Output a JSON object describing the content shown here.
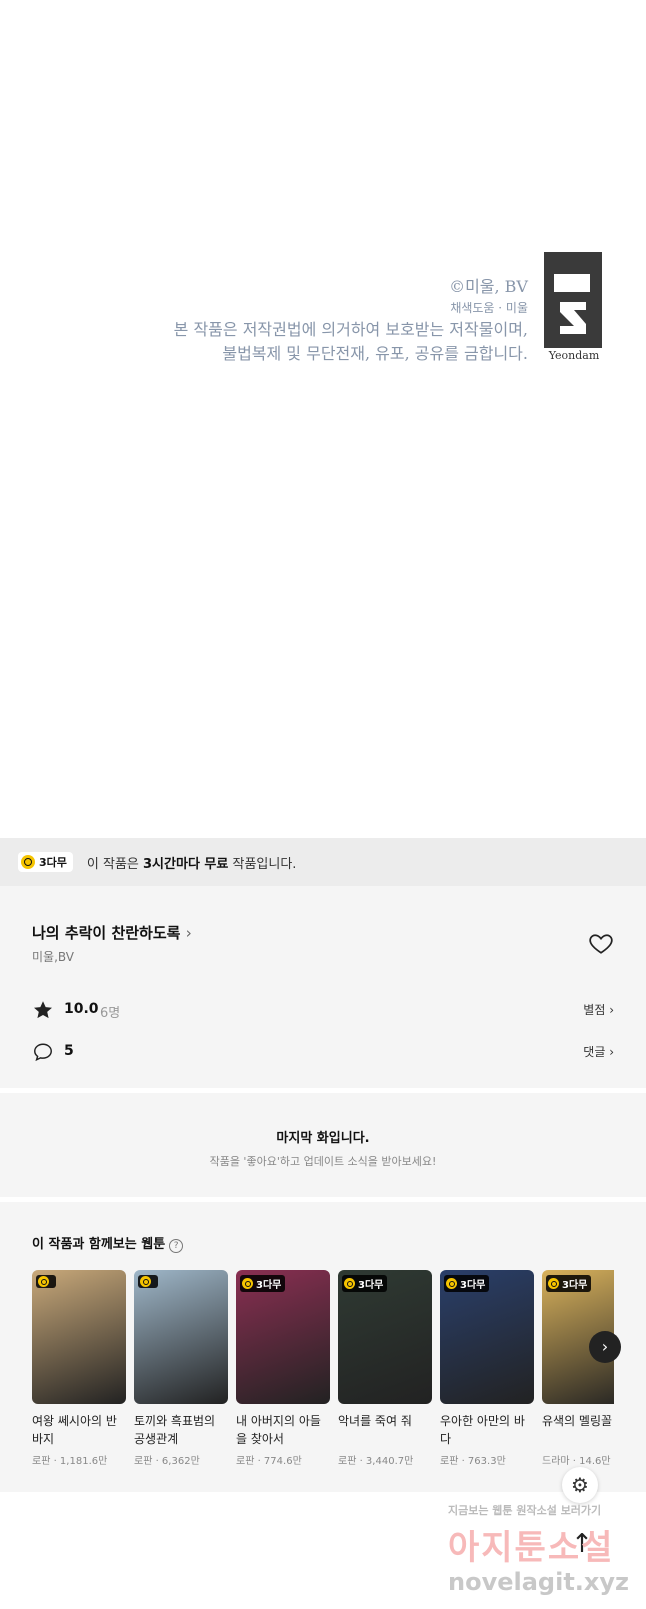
{
  "credits": {
    "copyright": "©미울, BV",
    "assist": "채색도움 · 미울",
    "notice_line1": "본 작품은 저작권법에 의거하여 보호받는 저작물이며,",
    "notice_line2": "불법복제 및 무단전재, 유포, 공유를 금합니다.",
    "logo_text": "Yeondam"
  },
  "free_banner": {
    "badge": "3다무",
    "text_prefix": "이 작품은 ",
    "text_bold": "3시간마다 무료",
    "text_suffix": " 작품입니다."
  },
  "work": {
    "title": "나의 추락이 찬란하도록",
    "title_chevron": "›",
    "author": "미울,BV",
    "rating": "10.0",
    "rating_count": "6명",
    "rating_link": "별점 ›",
    "comment_count": "5",
    "comment_link": "댓글 ›"
  },
  "last_episode": {
    "title": "마지막 화입니다.",
    "subtitle": "작품을 '좋아요'하고 업데이트 소식을 받아보세요!"
  },
  "recommendations": {
    "title": "이 작품과 함께보는 웹툰",
    "help": "?",
    "items": [
      {
        "name": "여왕 쎄시아의 반바지",
        "meta": "로판 · 1,181.6만",
        "badge": "",
        "color": "#c9a97a"
      },
      {
        "name": "토끼와 흑표범의 공생관계",
        "meta": "로판 · 6,362만",
        "badge": "",
        "color": "#9fb7c9"
      },
      {
        "name": "내 아버지의 아들을 찾아서",
        "meta": "로판 · 774.6만",
        "badge": "3다무",
        "color": "#8a2f52"
      },
      {
        "name": "악녀를 죽여 줘",
        "meta": "로판 · 3,440.7만",
        "badge": "3다무",
        "color": "#2f3a33"
      },
      {
        "name": "우아한 아만의 바다",
        "meta": "로판 · 763.3만",
        "badge": "3다무",
        "color": "#2a3f6a"
      },
      {
        "name": "유색의 멜링꼴",
        "meta": "드라마 · 14.6만",
        "badge": "3다무",
        "color": "#d9b25c"
      }
    ]
  },
  "watermark": {
    "line1": "지금보는 웹툰 원작소설 보러가기",
    "line2": "아지툰소설",
    "line3": "novelagit.xyz"
  }
}
